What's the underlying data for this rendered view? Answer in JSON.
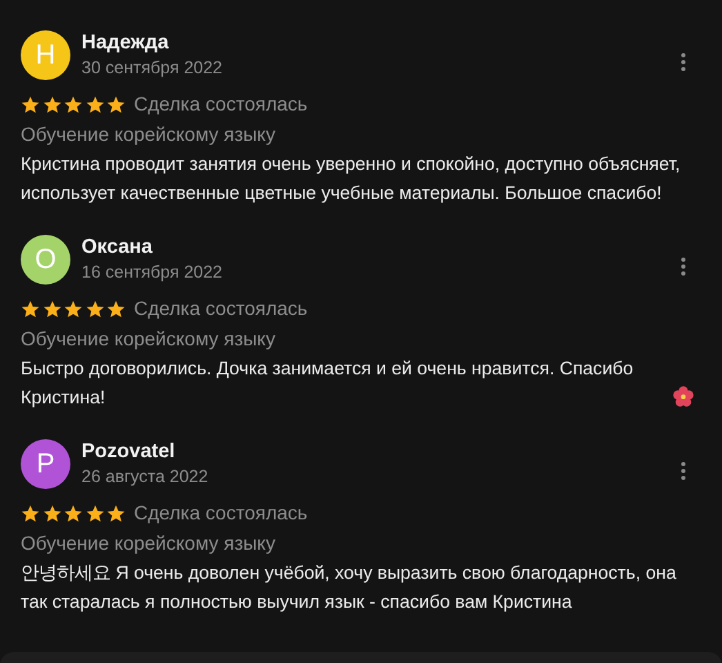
{
  "reviews": [
    {
      "initial": "Н",
      "color": "#f5c518",
      "name": "Надежда",
      "date": "30 сентября 2022",
      "stars": 5,
      "status": "Сделка состоялась",
      "service": "Обучение корейскому языку",
      "text": "Кристина проводит занятия очень уверенно и спокойно, доступно объясняет, использует качественные цветные учебные материалы. Большое спасибо!",
      "emoji": false
    },
    {
      "initial": "О",
      "color": "#a4d36a",
      "name": "Оксана",
      "date": "16 сентября 2022",
      "stars": 5,
      "status": "Сделка состоялась",
      "service": "Обучение корейскому языку",
      "text": "Быстро договорились. Дочка занимается и ей очень нравится. Спасибо Кристина!",
      "emoji": true
    },
    {
      "initial": "P",
      "color": "#b153d6",
      "name": "Pozovatel",
      "date": "26 августа 2022",
      "stars": 5,
      "status": "Сделка состоялась",
      "service": "Обучение корейскому языку",
      "text": "안녕하세요 Я очень доволен учёбой, хочу выразить свою благодарность, она так старалась  я полностью выучил язык  - спасибо вам Кристина",
      "emoji": false
    }
  ]
}
